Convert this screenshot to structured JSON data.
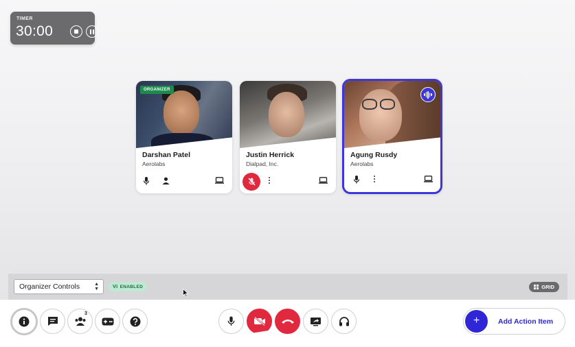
{
  "timer": {
    "label": "TIMER",
    "value": "30:00"
  },
  "participants": [
    {
      "name": "Darshan Patel",
      "company": "Aerolabs",
      "tag": "ORGANIZER",
      "mic_muted": false
    },
    {
      "name": "Justin Herrick",
      "company": "Dialpad, Inc.",
      "tag": "",
      "mic_muted": true
    },
    {
      "name": "Agung Rusdy",
      "company": "Aerolabs",
      "tag": "",
      "mic_muted": false,
      "speaking": true
    }
  ],
  "organizer_bar": {
    "select_value": "Organizer Controls",
    "vi_prefix": "Vi",
    "vi_status": "ENABLED",
    "layout_label": "GRID"
  },
  "toolbar": {
    "people_count": "3",
    "action_label": "Add Action Item",
    "action_icon": "+"
  },
  "colors": {
    "accent": "#2f27d6",
    "danger": "#e0283e",
    "organizer": "#1e8a4e",
    "speaking_border": "#3e36d6"
  }
}
